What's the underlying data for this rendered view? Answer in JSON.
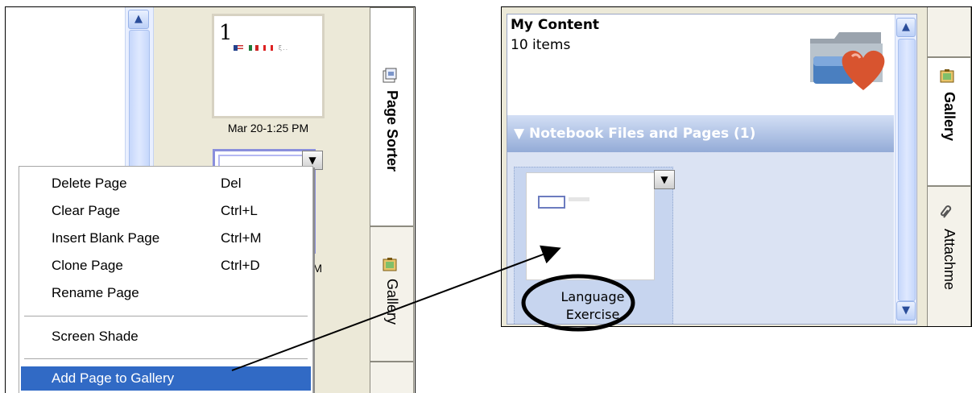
{
  "left_panel": {
    "thumbnails": [
      {
        "number": "1",
        "date": "Mar 20-1:25 PM"
      },
      {
        "date": "PM"
      }
    ],
    "tabs": {
      "page_sorter": "Page Sorter",
      "gallery": "Gallery"
    }
  },
  "context_menu": {
    "items": [
      {
        "label": "Delete Page",
        "shortcut": "Del"
      },
      {
        "label": "Clear Page",
        "shortcut": "Ctrl+L"
      },
      {
        "label": "Insert Blank Page",
        "shortcut": "Ctrl+M"
      },
      {
        "label": "Clone Page",
        "shortcut": "Ctrl+D"
      },
      {
        "label": "Rename Page",
        "shortcut": ""
      },
      {
        "label": "Screen Shade",
        "shortcut": ""
      },
      {
        "label": "Add Page to Gallery",
        "shortcut": ""
      }
    ],
    "highlighted": "Add Page to Gallery"
  },
  "right_panel": {
    "my_content": {
      "title": "My Content",
      "count": "10 items"
    },
    "section_header": "▼ Notebook Files and Pages (1)",
    "item": {
      "label_line1": "Language",
      "label_line2": "Exercise"
    },
    "tabs": {
      "gallery": "Gallery",
      "attachments": "Attachme"
    }
  },
  "icons": {
    "scroll_up": "▲",
    "scroll_down": "▼",
    "dropdown": "▼"
  },
  "colors": {
    "highlight": "#316ac5",
    "panel_bg": "#ece9d8",
    "section_header": "#93abd7"
  }
}
